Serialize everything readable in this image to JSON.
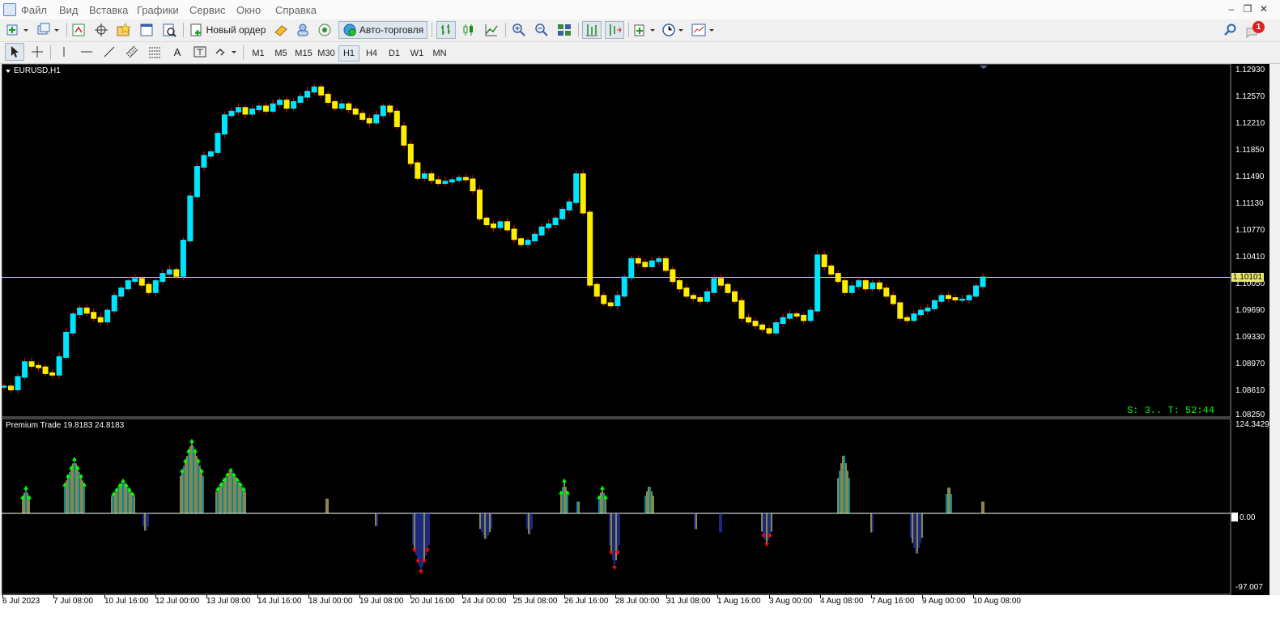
{
  "menu": {
    "items": [
      "Файл",
      "Вид",
      "Вставка",
      "Графики",
      "Сервис",
      "Окно",
      "Справка"
    ]
  },
  "toolbar": {
    "new_order_label": "Новый ордер",
    "autotrade_label": "Авто-торговля",
    "notification_count": "1"
  },
  "timeframes": [
    "M1",
    "M5",
    "M15",
    "M30",
    "H1",
    "H4",
    "D1",
    "W1",
    "MN"
  ],
  "active_timeframe": "H1",
  "chart": {
    "symbol_label": "EURUSD,H1",
    "current_price": "1.10101",
    "timer_text": "S: 3.. T: 52:44",
    "price_ticks": [
      "1.12930",
      "1.12570",
      "1.12210",
      "1.11850",
      "1.11490",
      "1.11130",
      "1.10770",
      "1.10410",
      "1.10050",
      "1.09690",
      "1.09330",
      "1.08970",
      "1.08610",
      "1.08250"
    ],
    "time_ticks": [
      "6 Jul 2023",
      "7 Jul 08:00",
      "10 Jul 16:00",
      "12 Jul 00:00",
      "13 Jul 08:00",
      "14 Jul 16:00",
      "18 Jul 00:00",
      "19 Jul 08:00",
      "20 Jul 16:00",
      "24 Jul 00:00",
      "25 Jul 08:00",
      "26 Jul 16:00",
      "28 Jul 00:00",
      "31 Jul 08:00",
      "1 Aug 16:00",
      "3 Aug 00:00",
      "4 Aug 08:00",
      "7 Aug 16:00",
      "9 Aug 00:00",
      "10 Aug 08:00"
    ]
  },
  "indicator": {
    "label": "Premium Trade 19.8183 24.8183",
    "max_label": "124.3429",
    "zero_label": "0.00",
    "min_label": "-97.007"
  },
  "colors": {
    "bull": "#00e5ff",
    "bear": "#ffee00",
    "wick": "#ff0000",
    "price_line": "#e8e86a",
    "up_arrow": "#00ff00",
    "down_arrow": "#ff0000",
    "hist_blue": "#2b45d6",
    "timer": "#00ff00"
  },
  "chart_data": {
    "type": "candlestick",
    "series": [
      {
        "name": "EURUSD,H1",
        "values": [
          1.0862,
          1.0858,
          1.0875,
          1.0895,
          1.089,
          1.0888,
          1.088,
          1.0878,
          1.0902,
          1.0935,
          1.096,
          1.0968,
          1.0962,
          1.0955,
          1.095,
          1.0965,
          1.0985,
          1.0995,
          1.1005,
          1.1008,
          1.1,
          1.099,
          1.1005,
          1.1015,
          1.102,
          1.1012,
          1.106,
          1.112,
          1.116,
          1.1175,
          1.118,
          1.1205,
          1.123,
          1.1235,
          1.124,
          1.1232,
          1.1238,
          1.1242,
          1.1236,
          1.1245,
          1.125,
          1.124,
          1.1248,
          1.1255,
          1.1262,
          1.1268,
          1.1258,
          1.1248,
          1.124,
          1.1245,
          1.1238,
          1.1232,
          1.1225,
          1.122,
          1.123,
          1.1242,
          1.1235,
          1.1215,
          1.119,
          1.1165,
          1.1145,
          1.115,
          1.1142,
          1.1138,
          1.114,
          1.1142,
          1.1145,
          1.1143,
          1.1128,
          1.109,
          1.1082,
          1.1078,
          1.1085,
          1.1075,
          1.1062,
          1.1055,
          1.106,
          1.1068,
          1.1078,
          1.1082,
          1.109,
          1.1102,
          1.1112,
          1.115,
          1.1098,
          1.1,
          1.0985,
          1.0975,
          1.0972,
          1.0985,
          1.101,
          1.1035,
          1.103,
          1.1025,
          1.1032,
          1.1035,
          1.102,
          1.1005,
          1.0995,
          1.0985,
          1.0982,
          1.0978,
          1.099,
          1.1008,
          1.1,
          1.099,
          1.0978,
          1.0955,
          1.095,
          1.0945,
          1.094,
          1.0935,
          1.0948,
          1.0955,
          1.096,
          1.0958,
          1.0952,
          1.0965,
          1.104,
          1.1025,
          1.1015,
          1.1005,
          1.099,
          1.0998,
          1.1005,
          1.0995,
          1.1002,
          1.0995,
          1.0985,
          1.0975,
          1.0955,
          1.0952,
          1.096,
          1.0965,
          1.0968,
          1.0978,
          1.0985,
          1.0982,
          1.098,
          1.098,
          1.0985,
          1.0998,
          1.101
        ]
      }
    ],
    "ylim": [
      1.0825,
      1.1293
    ],
    "indicator": {
      "name": "Premium Trade 19.8183 24.8183",
      "ylim": [
        -97.007,
        124.3429
      ]
    }
  }
}
